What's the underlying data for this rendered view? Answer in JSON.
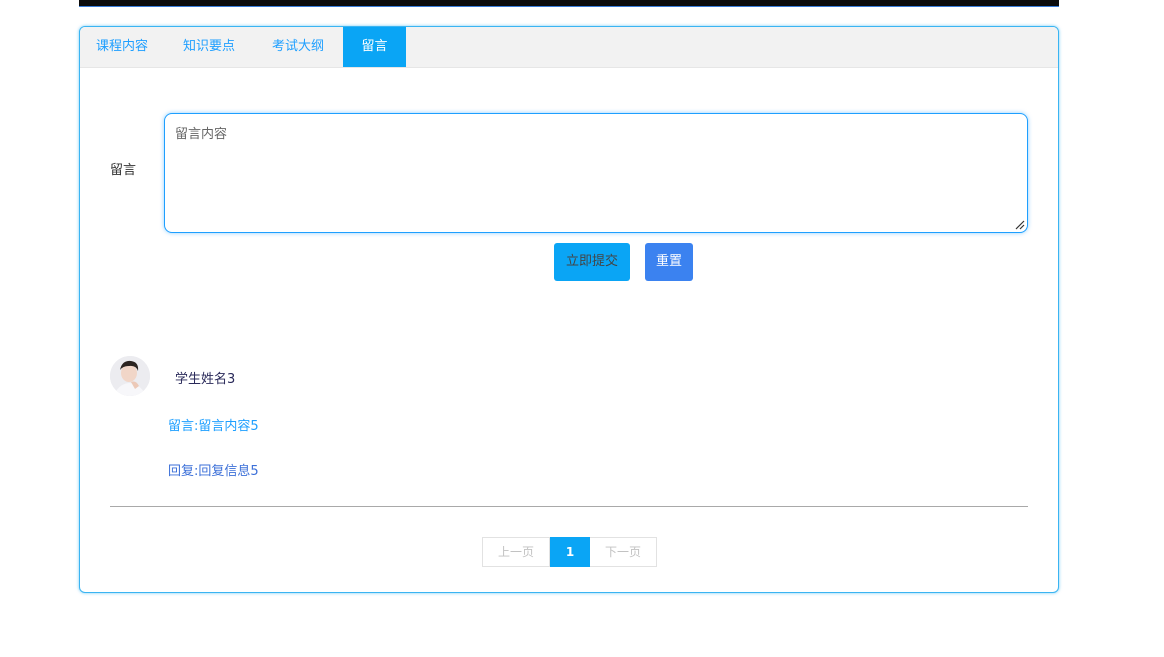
{
  "tabs": [
    {
      "label": "课程内容"
    },
    {
      "label": "知识要点"
    },
    {
      "label": "考试大纲"
    },
    {
      "label": "留言",
      "active": true
    }
  ],
  "form": {
    "field_label": "留言",
    "textarea_placeholder": "留言内容",
    "textarea_value": "",
    "submit_label": "立即提交",
    "reset_label": "重置"
  },
  "comments": [
    {
      "student_name": "学生姓名3",
      "message": "留言:留言内容5",
      "reply": "回复:回复信息5"
    }
  ],
  "pagination": {
    "prev_label": "上一页",
    "current_page": "1",
    "next_label": "下一页"
  },
  "colors": {
    "accent": "#0aa5f5",
    "reset_button": "#3b82f0",
    "tab_text": "#1e9fff"
  }
}
